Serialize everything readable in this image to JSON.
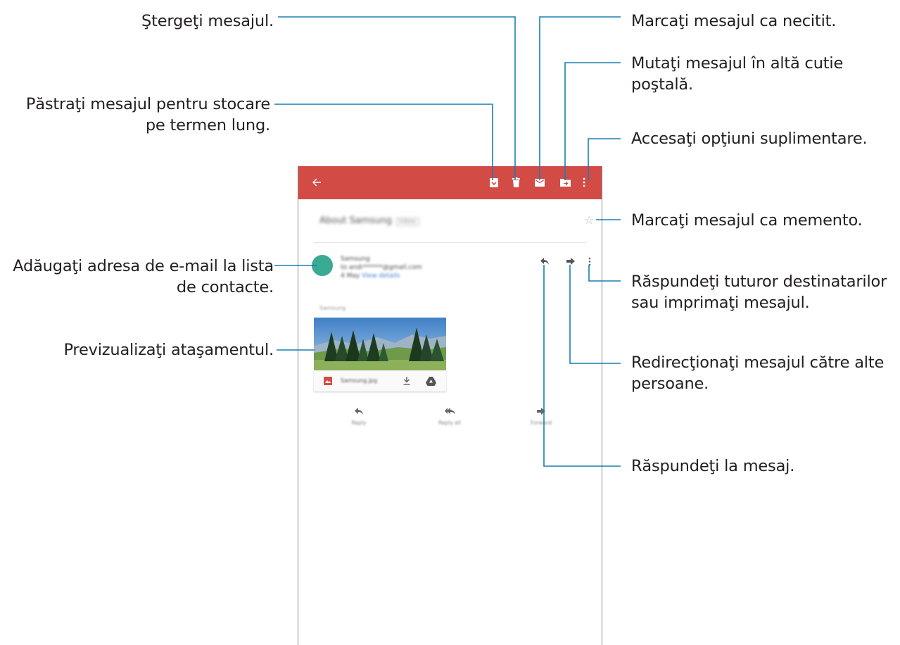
{
  "callouts": {
    "delete": "Ştergeţi mesajul.",
    "archive": [
      "Păstraţi mesajul pentru stocare",
      "pe termen lung."
    ],
    "add_contact": [
      "Adăugaţi adresa de e-mail la lista",
      "de contacte."
    ],
    "preview": "Previzualizaţi ataşamentul.",
    "mark_unread": "Marcaţi mesajul ca necitit.",
    "move": [
      "Mutaţi mesajul în altă cutie",
      "poştală."
    ],
    "more": "Accesaţi opţiuni suplimentare.",
    "star": "Marcaţi mesajul ca memento.",
    "reply_all_print": [
      "Răspundeţi tuturor destinatarilor",
      "sau imprimaţi mesajul."
    ],
    "forward": [
      "Redirecţionaţi mesajul către alte",
      "persoane."
    ],
    "reply": "Răspundeţi la mesaj."
  },
  "email": {
    "subject": "About Samsung",
    "subject_tag": "Inbox",
    "sender_name": "Samsung",
    "sender_email": "to andr******@gmail.com",
    "sender_date": "4 May",
    "sender_details_link": "View details",
    "attachment_label": "Samsung",
    "attachment_name": "Samsung.jpg",
    "actions": [
      "Reply",
      "Reply all",
      "Forward"
    ]
  },
  "icons": {
    "back": "back-arrow-icon",
    "archive": "archive-icon",
    "delete": "trash-icon",
    "unread": "envelope-icon",
    "move": "folder-move-icon",
    "more": "more-vert-icon",
    "star": "star-outline-icon",
    "reply": "reply-icon",
    "forward": "forward-icon",
    "image": "image-icon",
    "download": "download-icon",
    "drive": "drive-icon"
  },
  "colors": {
    "appbar": "#d24b45",
    "callout_line": "#1a7fb0",
    "avatar": "#3aaa94",
    "text": "#231f20"
  }
}
